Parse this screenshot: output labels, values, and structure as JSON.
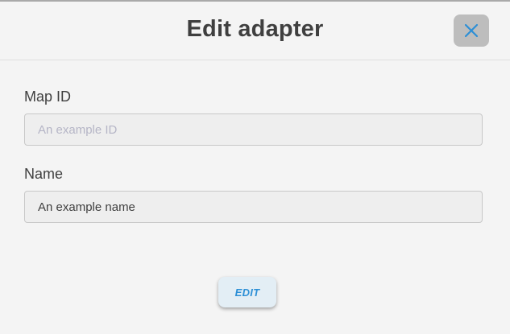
{
  "dialog": {
    "title": "Edit adapter",
    "close_icon": "close-icon",
    "accent_color": "#2c8fd6"
  },
  "fields": {
    "map_id": {
      "label": "Map ID",
      "value": "",
      "placeholder": "An example ID"
    },
    "name": {
      "label": "Name",
      "value": "An example name",
      "placeholder": ""
    }
  },
  "actions": {
    "edit_label": "EDIT"
  }
}
